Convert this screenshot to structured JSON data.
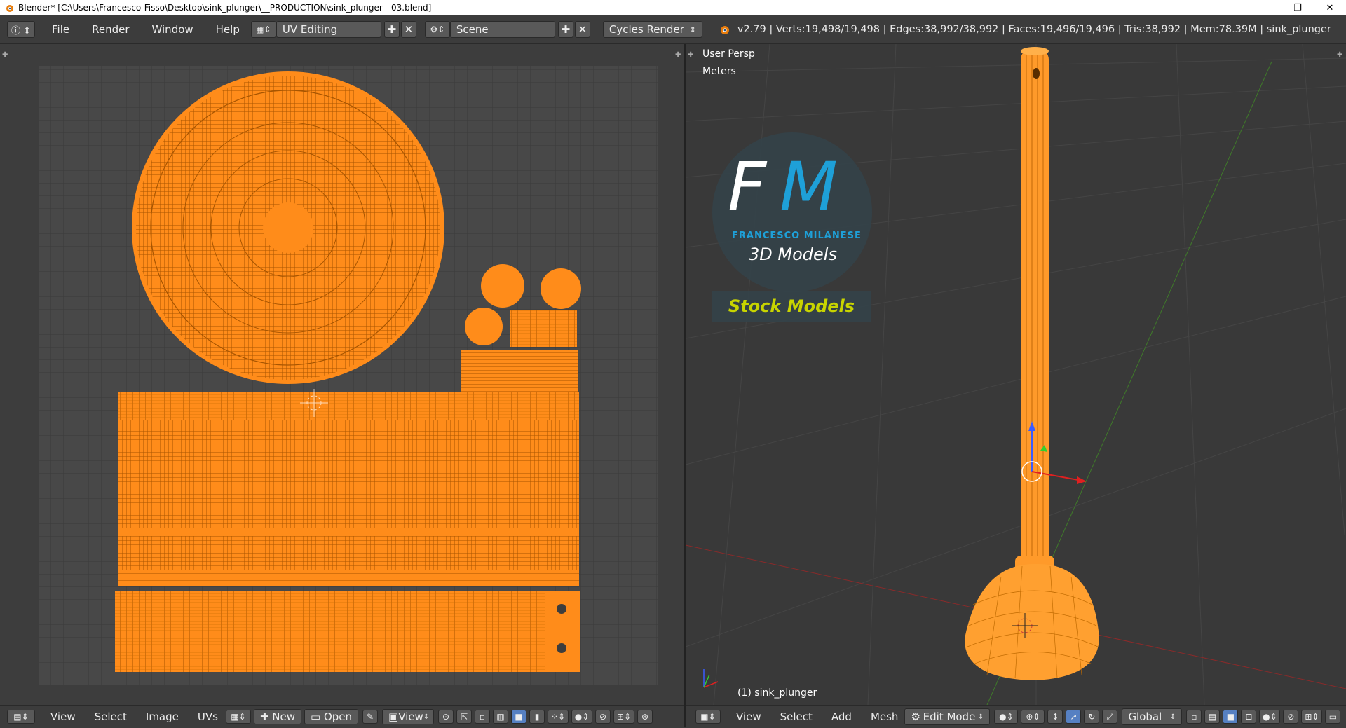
{
  "window": {
    "title": "Blender* [C:\\Users\\Francesco-Fisso\\Desktop\\sink_plunger\\__PRODUCTION\\sink_plunger---03.blend]",
    "minimize": "–",
    "maximize": "❐",
    "close": "✕"
  },
  "menu": {
    "items": [
      "File",
      "Render",
      "Window",
      "Help"
    ],
    "screen_layout": "UV Editing",
    "scene": "Scene",
    "render_engine": "Cycles Render",
    "stats": "v2.79 | Verts:19,498/19,498 | Edges:38,992/38,992 | Faces:19,496/19,496 | Tris:38,992 | Mem:78.39M | sink_plunger"
  },
  "uv_editor": {
    "menus": [
      "View",
      "Select",
      "Image",
      "UVs"
    ],
    "new_label": "New",
    "open_label": "Open",
    "view_label": "View"
  },
  "viewport": {
    "view_name": "User Persp",
    "units": "Meters",
    "object_label": "(1) sink_plunger",
    "menus": [
      "View",
      "Select",
      "Add",
      "Mesh"
    ],
    "mode": "Edit Mode",
    "orientation": "Global",
    "watermark": {
      "initials_f": "F",
      "initials_m": "M",
      "author": "FRANCESCO MILANESE",
      "subtitle": "3D Models",
      "badge": "Stock Models"
    }
  },
  "colors": {
    "uv_orange": "#ff8c1a",
    "wire_dark": "#b35c00",
    "grid_bg": "#484848",
    "accent_blue": "#1ea0d8",
    "badge_yellow": "#c8d400"
  },
  "icons": [
    "info-icon",
    "screen-layout-icon",
    "scene-icon",
    "blender-logo-icon",
    "editor-type-icon",
    "pin-icon",
    "cube-icon"
  ]
}
